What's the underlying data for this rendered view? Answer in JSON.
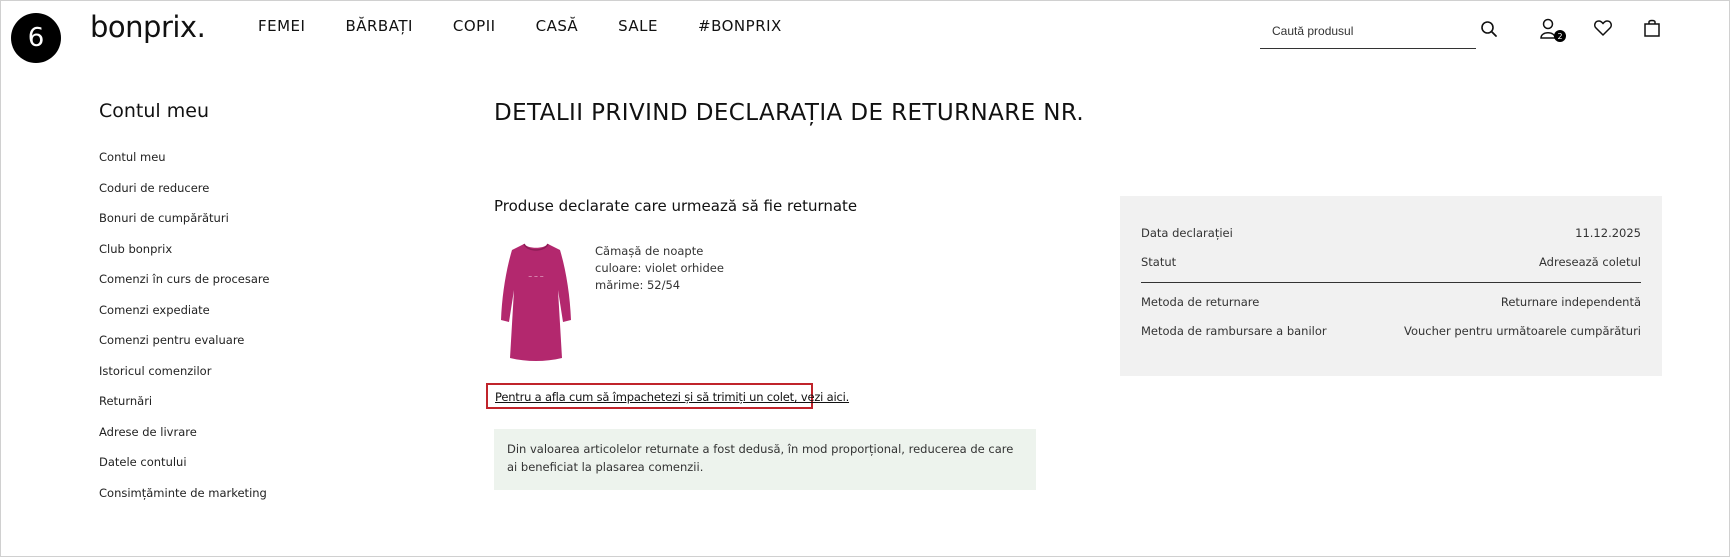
{
  "step": "6",
  "header": {
    "logo": "bonprix.",
    "nav": [
      "FEMEI",
      "BĂRBAȚI",
      "COPII",
      "CASĂ",
      "SALE",
      "#BONPRIX"
    ],
    "search_placeholder": "Caută produsul",
    "account_badge": "2"
  },
  "sidebar": {
    "title": "Contul meu",
    "items": [
      "Contul meu",
      "Coduri de reducere",
      "Bonuri de cumpărături",
      "Club bonprix",
      "Comenzi în curs de procesare",
      "Comenzi expediate",
      "Comenzi pentru evaluare",
      "Istoricul comenzilor",
      "Returnări",
      "Adrese de livrare",
      "Datele contului",
      "Consimțăminte de marketing"
    ]
  },
  "main": {
    "title": "DETALII PRIVIND DECLARAȚIA DE RETURNARE NR.",
    "section_title": "Produse declarate care urmează să fie returnate",
    "product": {
      "name": "Cămașă de noapte",
      "color": "culoare: violet orhidee",
      "size": "mărime: 52/54",
      "image_color": "#b3286e"
    },
    "help_link": "Pentru a afla cum să împachetezi și să trimiți un colet, vezi aici.",
    "notice": "Din valoarea articolelor returnate a fost dedusă, în mod proporțional, reducerea de care ai beneficiat la plasarea comenzii."
  },
  "summary": {
    "rows_top": [
      {
        "label": "Data declarației",
        "value": "11.12.2025"
      },
      {
        "label": "Statut",
        "value": "Adresează coletul"
      }
    ],
    "rows_bottom": [
      {
        "label": "Metoda de returnare",
        "value": "Returnare independentă"
      },
      {
        "label": "Metoda de rambursare a banilor",
        "value": "Voucher pentru următoarele cumpărături"
      }
    ]
  },
  "colors": {
    "highlight_border": "#c0242b",
    "notice_bg": "#edf3ed",
    "summary_bg": "#f1f1f1"
  }
}
